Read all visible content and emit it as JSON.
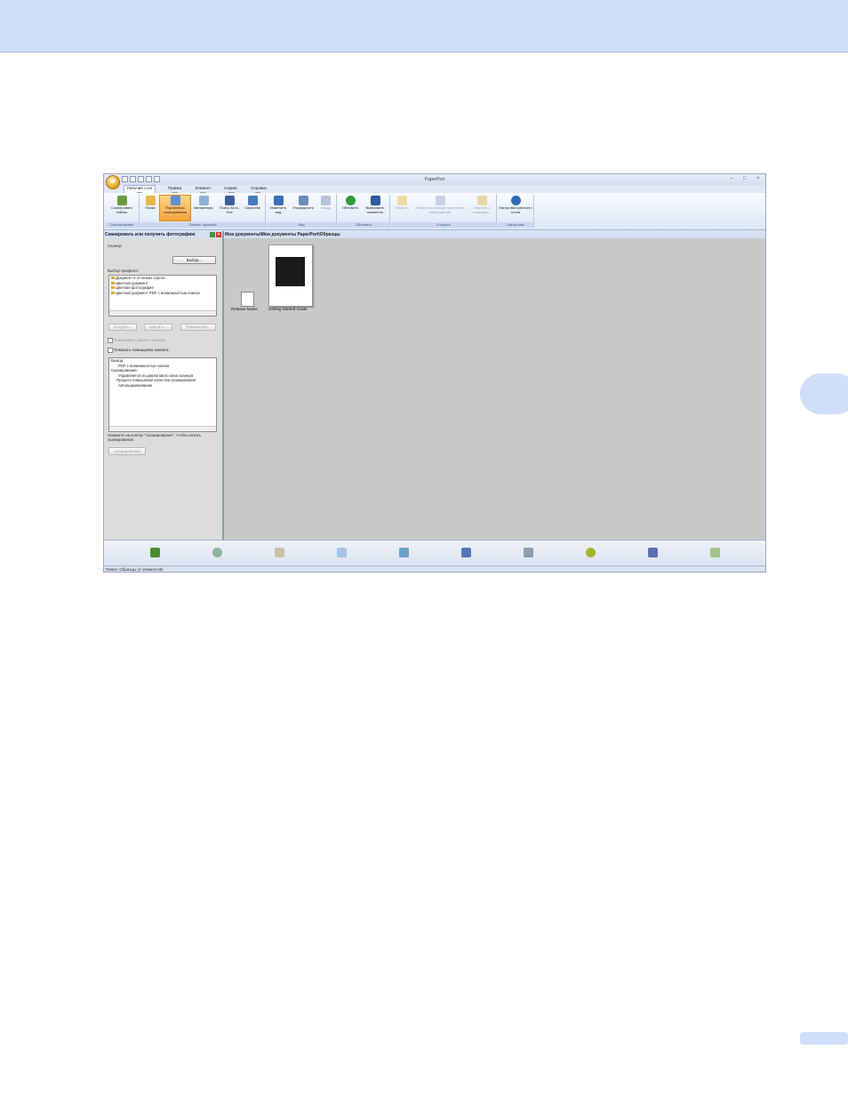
{
  "app": {
    "title": "PaperPort",
    "orb_glyph": "✉",
    "window_controls": [
      "–",
      "□",
      "×"
    ]
  },
  "ribbon": {
    "tabs": [
      {
        "label": "Рабочий стол",
        "keytip": "Д"
      },
      {
        "label": "Правка",
        "keytip": "П"
      },
      {
        "label": "Элемент",
        "keytip": "Э"
      },
      {
        "label": "Сервис",
        "keytip": "С"
      },
      {
        "label": "Справка",
        "keytip": "Б"
      }
    ],
    "groups": {
      "scan": {
        "label": "Сканирование",
        "buttons": [
          "Сканировать сейчас"
        ]
      },
      "functions": {
        "label": "Панель функций",
        "buttons": [
          "Папки",
          "Параметры сканирования",
          "Миниатюры",
          "Поиск All-in-One",
          "Свойства"
        ]
      },
      "view": {
        "label": "Вид",
        "buttons": [
          "Изменить вид",
          "Упорядочить",
          "Назад"
        ]
      },
      "refresh": {
        "label": "Обновить",
        "buttons": [
          "Обновить",
          "Выпрямить элементы"
        ]
      },
      "open": {
        "label": "Открыть",
        "buttons": [
          "Открыть",
          "Открыть в режиме просмотра изображений",
          "Открыть с помощью..."
        ]
      },
      "settings": {
        "label": "Настройки",
        "buttons": [
          "Настройки рабочего стола"
        ]
      }
    }
  },
  "left_panel": {
    "header": "Сканировать или получить фотографию",
    "scanner_label": "Сканер:",
    "select_button": "Выбор...",
    "profile_label": "Выбор профиля:",
    "profiles": [
      "Документ в оттенках серого",
      "Цветной документ",
      "Цветная фотография",
      "Цветной документ PDF с возможностью поиска"
    ],
    "buttons": [
      "Создать...",
      "Удалить...",
      "Параметры..."
    ],
    "checkbox_dialog": "Показывать диалог сканера",
    "checkbox_assistant": "Показать помощника захвата",
    "process_items": [
      "Вывод:",
      "PDF с возможностью поиска",
      "Сканирование:",
      "Управляется из диалогового окна сканера",
      "Процесс повышения качества сканирования",
      "Автовыравнивание"
    ],
    "hint": "Нажмите на кнопку \"Сканирование\", чтобы начать сканирование.",
    "scan_button": "Сканирование"
  },
  "main_panel": {
    "path": "Мои документы\\Мои документы PaperPort\\Образцы",
    "items": [
      {
        "label": "Release Notes"
      },
      {
        "label": "Getting Started Guide"
      }
    ]
  },
  "bottom_icons": [
    "scanner-icon",
    "mail-icon",
    "edit-icon",
    "window-icon",
    "book-icon",
    "ftp-icon",
    "printer-icon",
    "hexagon-icon",
    "people-icon",
    "paint-icon"
  ],
  "status": {
    "text": "Папка: Образцы (2 элементов)"
  },
  "colors": {
    "page_header": "#cfdef9",
    "active_ribbon_button": "#f6a33a",
    "panel_header": "#d4dff2"
  }
}
